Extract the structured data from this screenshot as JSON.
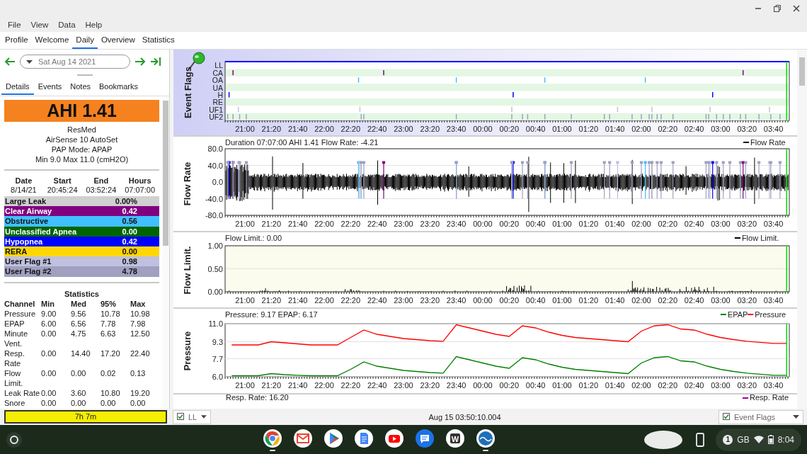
{
  "menu": [
    "File",
    "View",
    "Data",
    "Help"
  ],
  "tabs": [
    {
      "label": "Profile",
      "selected": false
    },
    {
      "label": "Welcome",
      "selected": false
    },
    {
      "label": "Daily",
      "selected": true
    },
    {
      "label": "Overview",
      "selected": false
    },
    {
      "label": "Statistics",
      "selected": false
    }
  ],
  "daily": {
    "date": "Sat Aug 14 2021",
    "subtabs": [
      {
        "label": "Details",
        "selected": true
      },
      {
        "label": "Events",
        "selected": false
      },
      {
        "label": "Notes",
        "selected": false
      },
      {
        "label": "Bookmarks",
        "selected": false
      }
    ],
    "ahi": "AHI 1.41",
    "machine": [
      "ResMed",
      "AirSense 10 AutoSet",
      "PAP Mode: APAP",
      "Min 9.0 Max 11.0 (cmH2O)"
    ],
    "session": {
      "columns": [
        "Date",
        "Start",
        "End",
        "Hours"
      ],
      "row": [
        "8/14/21",
        "20:45:24",
        "03:52:24",
        "07:07:00"
      ]
    },
    "indices": [
      {
        "name": "Large Leak",
        "value": "0.00%",
        "color": "#d0d0d0"
      },
      {
        "name": "Clear Airway",
        "value": "0.42",
        "color": "#800080"
      },
      {
        "name": "Obstructive",
        "value": "0.56",
        "color": "#40c0ff"
      },
      {
        "name": "Unclassified Apnea",
        "value": "0.00",
        "color": "#006400"
      },
      {
        "name": "Hypopnea",
        "value": "0.42",
        "color": "#0000ff"
      },
      {
        "name": "RERA",
        "value": "0.00",
        "color": "#ffd700"
      },
      {
        "name": "User Flag #1",
        "value": "0.98",
        "color": "#c0c0e0"
      },
      {
        "name": "User Flag #2",
        "value": "4.78",
        "color": "#a0a0c0"
      }
    ],
    "statistics": {
      "title": "Statistics",
      "columns": [
        "Channel",
        "Min",
        "Med",
        "95%",
        "Max"
      ],
      "rows": [
        [
          "Pressure",
          "9.00",
          "9.56",
          "10.78",
          "10.98"
        ],
        [
          "EPAP",
          "6.00",
          "6.56",
          "7.78",
          "7.98"
        ],
        [
          "Minute Vent.",
          "0.00",
          "4.75",
          "6.63",
          "12.50"
        ],
        [
          "Resp. Rate",
          "0.00",
          "14.40",
          "17.20",
          "22.40"
        ],
        [
          "Flow Limit.",
          "0.00",
          "0.00",
          "0.02",
          "0.13"
        ],
        [
          "Leak Rate",
          "0.00",
          "3.60",
          "10.80",
          "19.20"
        ],
        [
          "Snore",
          "0.00",
          "0.00",
          "0.00",
          "0.00"
        ]
      ]
    },
    "duration": "7h 7m"
  },
  "charts": [
    {
      "kind": "flags",
      "title": "Event Flags",
      "rows": [
        "LL",
        "CA",
        "OA",
        "UA",
        "H",
        "RE",
        "UF1",
        "UF2"
      ],
      "xticks": [
        "21:00",
        "21:20",
        "21:40",
        "22:00",
        "22:20",
        "22:40",
        "23:00",
        "23:20",
        "23:40",
        "00:00",
        "00:20",
        "00:40",
        "01:00",
        "01:20",
        "01:40",
        "02:00",
        "02:20",
        "02:40",
        "03:00",
        "03:20",
        "03:40"
      ]
    },
    {
      "kind": "wave",
      "title": "Flow Rate",
      "header": "Duration 07:07:00 AHI 1.41 Flow Rate: -4.21",
      "legend": [
        {
          "name": "Flow Rate",
          "color": "#000000"
        }
      ],
      "yticks": [
        "80.0",
        "40.0",
        "0.0",
        "-40.0",
        "-80.0"
      ],
      "xticks": [
        "21:00",
        "21:20",
        "21:40",
        "22:00",
        "22:20",
        "22:40",
        "23:00",
        "23:20",
        "23:40",
        "00:00",
        "00:20",
        "00:40",
        "01:00",
        "01:20",
        "01:40",
        "02:00",
        "02:20",
        "02:40",
        "03:00",
        "03:20",
        "03:40"
      ]
    },
    {
      "kind": "spikes",
      "title": "Flow Limit.",
      "header": "Flow Limit.: 0.00",
      "legend": [
        {
          "name": "Flow Limit.",
          "color": "#000000"
        }
      ],
      "yticks": [
        "1.00",
        "0.50",
        "0.00"
      ],
      "xticks": [
        "21:00",
        "21:20",
        "21:40",
        "22:00",
        "22:20",
        "22:40",
        "23:00",
        "23:20",
        "23:40",
        "00:00",
        "00:20",
        "00:40",
        "01:00",
        "01:20",
        "01:40",
        "02:00",
        "02:20",
        "02:40",
        "03:00",
        "03:20",
        "03:40"
      ]
    },
    {
      "kind": "line",
      "title": "Pressure",
      "header": "Pressure: 9.17 EPAP: 6.17",
      "chart_data": {
        "type": "line",
        "ylim": [
          6,
          11
        ],
        "legend": "top right",
        "yticks": [
          {
            "value": 11,
            "label": "11.0"
          },
          {
            "value": 9.3,
            "label": "9.3"
          },
          {
            "value": 7.7,
            "label": "7.7"
          },
          {
            "value": 6,
            "label": "6.0"
          }
        ],
        "categories": [
          null,
          "21:00",
          null,
          "21:20",
          null,
          "21:40",
          null,
          "22:00",
          null,
          "22:20",
          null,
          "22:40",
          null,
          "23:00",
          null,
          "23:20",
          null,
          "23:40",
          null,
          "00:00",
          null,
          "00:20",
          null,
          "00:40",
          null,
          "01:00",
          null,
          "01:20",
          null,
          "01:40",
          null,
          "02:00",
          null,
          "02:20",
          null,
          "02:40",
          null,
          "03:00",
          null,
          "03:20",
          null,
          "03:40",
          null
        ],
        "series": [
          {
            "name": "EPAP",
            "color": "#008000",
            "values": [
              6.1,
              6.1,
              6.1,
              6.3,
              6.2,
              6.15,
              6.1,
              6.1,
              6.1,
              6.7,
              7.4,
              7.0,
              6.8,
              6.6,
              6.5,
              6.4,
              6.35,
              7.9,
              7.6,
              7.3,
              7.0,
              6.8,
              7.8,
              7.6,
              7.2,
              6.9,
              6.7,
              6.6,
              6.5,
              6.4,
              6.3,
              7.3,
              7.8,
              7.9,
              7.5,
              7.4,
              7.0,
              6.7,
              6.5,
              6.35,
              6.25,
              6.15,
              6.15
            ]
          },
          {
            "name": "Pressure",
            "color": "#ff0000",
            "values": [
              9.0,
              9.0,
              9.0,
              9.3,
              9.2,
              9.1,
              9.0,
              9.0,
              9.0,
              9.7,
              10.4,
              10.0,
              9.8,
              9.6,
              9.5,
              9.4,
              9.35,
              10.9,
              10.6,
              10.3,
              10.0,
              9.8,
              10.8,
              10.6,
              10.2,
              9.9,
              9.7,
              9.6,
              9.5,
              9.4,
              9.3,
              10.3,
              10.8,
              10.9,
              10.5,
              10.4,
              10.0,
              9.7,
              9.5,
              9.35,
              9.25,
              9.15,
              9.15
            ]
          }
        ]
      }
    },
    {
      "kind": "partial",
      "header": "Resp. Rate: 16.20",
      "legend": [
        {
          "name": "Resp. Rate",
          "color": "#a000a0"
        }
      ]
    }
  ],
  "status_bar": {
    "left_combo": {
      "label": "LL",
      "checked": true
    },
    "time": "Aug 15 03:50:10.004",
    "right_combo": {
      "label": "Event Flags",
      "checked": true
    }
  },
  "taskbar": {
    "apps": [
      {
        "kind": "browser",
        "running": true
      },
      {
        "kind": "mail",
        "running": false
      },
      {
        "kind": "store",
        "running": false
      },
      {
        "kind": "docs",
        "running": false
      },
      {
        "kind": "video",
        "running": false
      },
      {
        "kind": "chat",
        "running": false
      },
      {
        "kind": "letter",
        "letter": "W",
        "running": false
      },
      {
        "kind": "oscar",
        "running": true
      }
    ],
    "tray": {
      "badge": "1",
      "network": "GB",
      "time": "8:04"
    }
  }
}
